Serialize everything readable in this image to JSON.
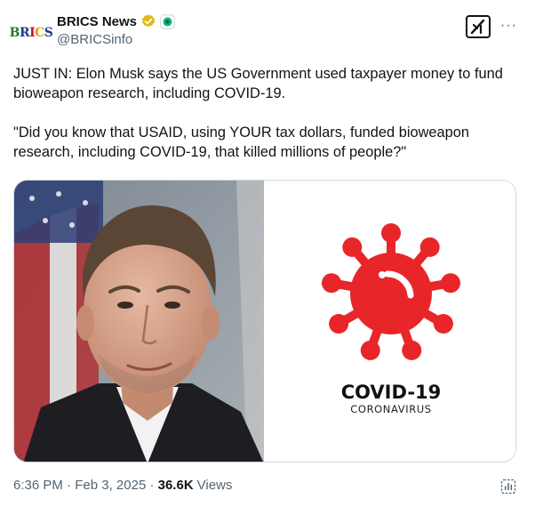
{
  "author": {
    "avatar_text": "BRICS",
    "display_name": "BRICS News",
    "handle": "@BRICSinfo",
    "verified_badge_color": "#e2b719",
    "affiliate_badge_color": "#00ba7c"
  },
  "icons": {
    "grok": "grok-icon",
    "more": "more-icon",
    "verified": "verified-badge-icon",
    "affiliate": "affiliate-badge-icon",
    "analytics": "post-analytics-icon"
  },
  "more_label": "···",
  "tweet": {
    "paragraphs": [
      "JUST IN: Elon Musk says the US Government used taxpayer money to fund bioweapon research, including COVID-19.",
      "\"Did you know that USAID, using YOUR tax dollars, funded bioweapon research, including COVID-19, that killed millions of people?\""
    ]
  },
  "media": {
    "covid_title": "COVID-19",
    "covid_subtitle": "CORONAVIRUS",
    "virus_color": "#e8262a"
  },
  "meta": {
    "time": "6:36 PM",
    "separator": " · ",
    "date": "Feb 3, 2025",
    "views_count": "36.6K",
    "views_label": "Views"
  }
}
